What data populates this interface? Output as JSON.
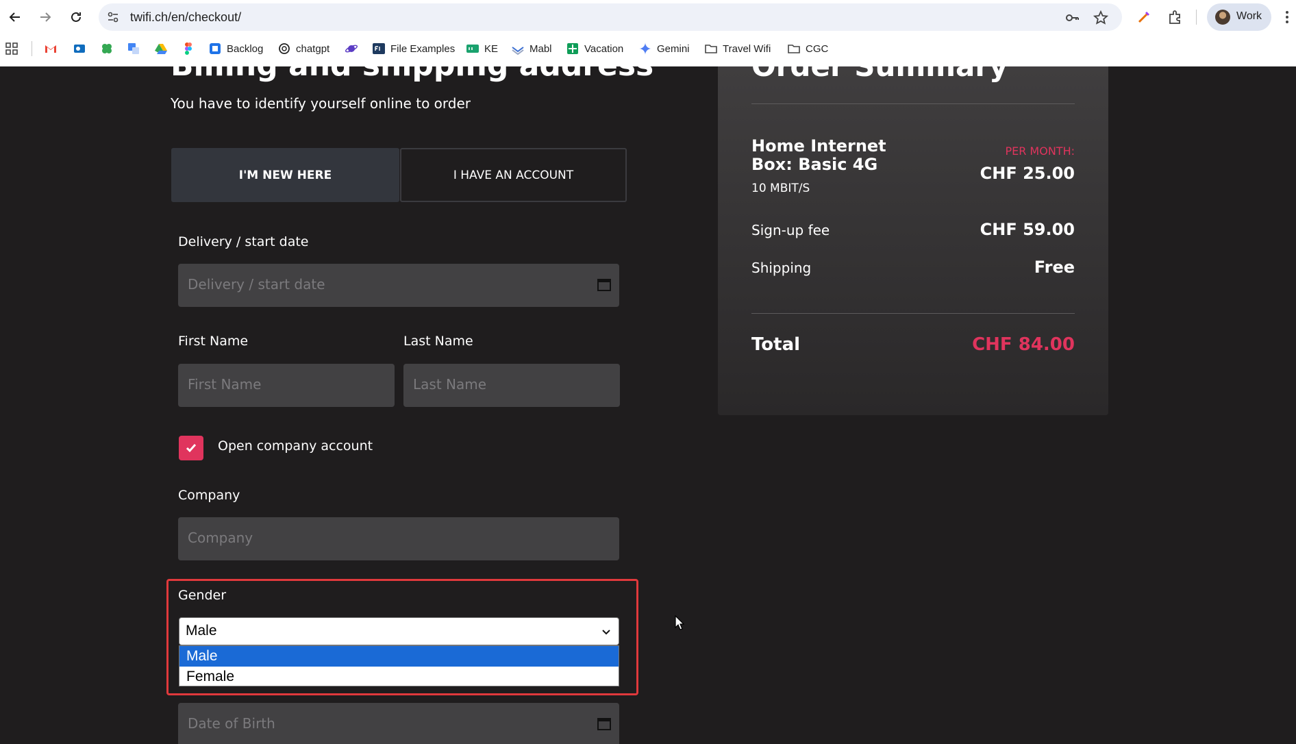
{
  "browser": {
    "url": "twifi.ch/en/checkout/",
    "profile_label": "Work",
    "bookmarks": [
      {
        "icon": "apps-grid-icon",
        "label": ""
      },
      {
        "icon": "gmail-icon",
        "label": ""
      },
      {
        "icon": "outlook-icon",
        "label": ""
      },
      {
        "icon": "clover-icon",
        "label": ""
      },
      {
        "icon": "translate-icon",
        "label": ""
      },
      {
        "icon": "google-drive-icon",
        "label": ""
      },
      {
        "icon": "figma-icon",
        "label": ""
      },
      {
        "icon": "backlog-icon",
        "label": "Backlog"
      },
      {
        "icon": "chatgpt-icon",
        "label": "chatgpt"
      },
      {
        "icon": "planet-icon",
        "label": ""
      },
      {
        "icon": "fex-icon",
        "label": "File Examples"
      },
      {
        "icon": "ke-icon",
        "label": "KE"
      },
      {
        "icon": "mabl-icon",
        "label": "Mabl"
      },
      {
        "icon": "sheets-icon",
        "label": "Vacation"
      },
      {
        "icon": "gemini-icon",
        "label": "Gemini"
      },
      {
        "icon": "folder-icon",
        "label": "Travel Wifi"
      },
      {
        "icon": "folder-icon",
        "label": "CGC"
      }
    ]
  },
  "checkout": {
    "heading": "Billing and shipping address",
    "subheading": "You have to identify yourself online to order",
    "tab_new": "I'M NEW HERE",
    "tab_account": "I HAVE AN ACCOUNT",
    "delivery_label": "Delivery / start date",
    "delivery_placeholder": "Delivery / start date",
    "first_name_label": "First Name",
    "first_name_placeholder": "First Name",
    "last_name_label": "Last Name",
    "last_name_placeholder": "Last Name",
    "company_checkbox_label": "Open company account",
    "company_checked": true,
    "company_label": "Company",
    "company_placeholder": "Company",
    "gender_label": "Gender",
    "gender_value": "Male",
    "gender_options": [
      "Male",
      "Female"
    ],
    "dob_placeholder": "Date of Birth"
  },
  "summary": {
    "title": "Order Summary",
    "product_name": "Home Internet Box: Basic 4G",
    "product_speed": "10 MBIT/S",
    "per_month_label": "PER MONTH:",
    "monthly_price": "CHF 25.00",
    "signup_label": "Sign-up fee",
    "signup_value": "CHF 59.00",
    "shipping_label": "Shipping",
    "shipping_value": "Free",
    "total_label": "Total",
    "total_value": "CHF 84.00"
  },
  "colors": {
    "accent": "#e0345d",
    "page_bg": "#1f1d1e",
    "highlight_border": "#e0393c",
    "selected_option": "#1a6ad6"
  }
}
